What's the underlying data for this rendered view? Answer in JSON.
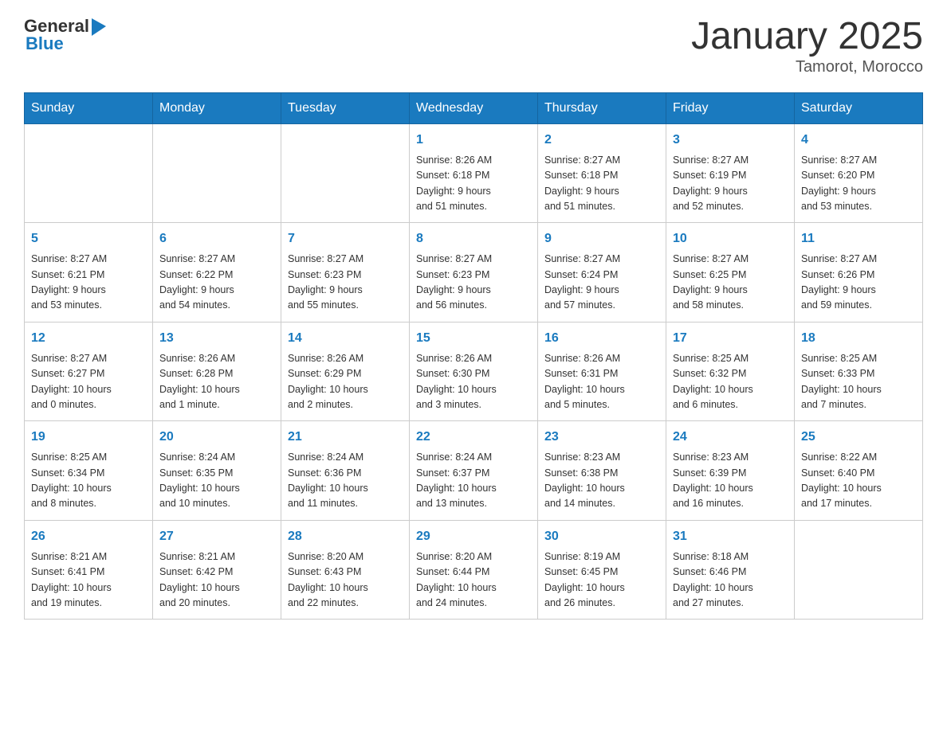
{
  "header": {
    "logo": {
      "general": "General",
      "blue": "Blue"
    },
    "title": "January 2025",
    "subtitle": "Tamorot, Morocco"
  },
  "weekdays": [
    "Sunday",
    "Monday",
    "Tuesday",
    "Wednesday",
    "Thursday",
    "Friday",
    "Saturday"
  ],
  "weeks": [
    [
      {
        "day": "",
        "info": ""
      },
      {
        "day": "",
        "info": ""
      },
      {
        "day": "",
        "info": ""
      },
      {
        "day": "1",
        "info": "Sunrise: 8:26 AM\nSunset: 6:18 PM\nDaylight: 9 hours\nand 51 minutes."
      },
      {
        "day": "2",
        "info": "Sunrise: 8:27 AM\nSunset: 6:18 PM\nDaylight: 9 hours\nand 51 minutes."
      },
      {
        "day": "3",
        "info": "Sunrise: 8:27 AM\nSunset: 6:19 PM\nDaylight: 9 hours\nand 52 minutes."
      },
      {
        "day": "4",
        "info": "Sunrise: 8:27 AM\nSunset: 6:20 PM\nDaylight: 9 hours\nand 53 minutes."
      }
    ],
    [
      {
        "day": "5",
        "info": "Sunrise: 8:27 AM\nSunset: 6:21 PM\nDaylight: 9 hours\nand 53 minutes."
      },
      {
        "day": "6",
        "info": "Sunrise: 8:27 AM\nSunset: 6:22 PM\nDaylight: 9 hours\nand 54 minutes."
      },
      {
        "day": "7",
        "info": "Sunrise: 8:27 AM\nSunset: 6:23 PM\nDaylight: 9 hours\nand 55 minutes."
      },
      {
        "day": "8",
        "info": "Sunrise: 8:27 AM\nSunset: 6:23 PM\nDaylight: 9 hours\nand 56 minutes."
      },
      {
        "day": "9",
        "info": "Sunrise: 8:27 AM\nSunset: 6:24 PM\nDaylight: 9 hours\nand 57 minutes."
      },
      {
        "day": "10",
        "info": "Sunrise: 8:27 AM\nSunset: 6:25 PM\nDaylight: 9 hours\nand 58 minutes."
      },
      {
        "day": "11",
        "info": "Sunrise: 8:27 AM\nSunset: 6:26 PM\nDaylight: 9 hours\nand 59 minutes."
      }
    ],
    [
      {
        "day": "12",
        "info": "Sunrise: 8:27 AM\nSunset: 6:27 PM\nDaylight: 10 hours\nand 0 minutes."
      },
      {
        "day": "13",
        "info": "Sunrise: 8:26 AM\nSunset: 6:28 PM\nDaylight: 10 hours\nand 1 minute."
      },
      {
        "day": "14",
        "info": "Sunrise: 8:26 AM\nSunset: 6:29 PM\nDaylight: 10 hours\nand 2 minutes."
      },
      {
        "day": "15",
        "info": "Sunrise: 8:26 AM\nSunset: 6:30 PM\nDaylight: 10 hours\nand 3 minutes."
      },
      {
        "day": "16",
        "info": "Sunrise: 8:26 AM\nSunset: 6:31 PM\nDaylight: 10 hours\nand 5 minutes."
      },
      {
        "day": "17",
        "info": "Sunrise: 8:25 AM\nSunset: 6:32 PM\nDaylight: 10 hours\nand 6 minutes."
      },
      {
        "day": "18",
        "info": "Sunrise: 8:25 AM\nSunset: 6:33 PM\nDaylight: 10 hours\nand 7 minutes."
      }
    ],
    [
      {
        "day": "19",
        "info": "Sunrise: 8:25 AM\nSunset: 6:34 PM\nDaylight: 10 hours\nand 8 minutes."
      },
      {
        "day": "20",
        "info": "Sunrise: 8:24 AM\nSunset: 6:35 PM\nDaylight: 10 hours\nand 10 minutes."
      },
      {
        "day": "21",
        "info": "Sunrise: 8:24 AM\nSunset: 6:36 PM\nDaylight: 10 hours\nand 11 minutes."
      },
      {
        "day": "22",
        "info": "Sunrise: 8:24 AM\nSunset: 6:37 PM\nDaylight: 10 hours\nand 13 minutes."
      },
      {
        "day": "23",
        "info": "Sunrise: 8:23 AM\nSunset: 6:38 PM\nDaylight: 10 hours\nand 14 minutes."
      },
      {
        "day": "24",
        "info": "Sunrise: 8:23 AM\nSunset: 6:39 PM\nDaylight: 10 hours\nand 16 minutes."
      },
      {
        "day": "25",
        "info": "Sunrise: 8:22 AM\nSunset: 6:40 PM\nDaylight: 10 hours\nand 17 minutes."
      }
    ],
    [
      {
        "day": "26",
        "info": "Sunrise: 8:21 AM\nSunset: 6:41 PM\nDaylight: 10 hours\nand 19 minutes."
      },
      {
        "day": "27",
        "info": "Sunrise: 8:21 AM\nSunset: 6:42 PM\nDaylight: 10 hours\nand 20 minutes."
      },
      {
        "day": "28",
        "info": "Sunrise: 8:20 AM\nSunset: 6:43 PM\nDaylight: 10 hours\nand 22 minutes."
      },
      {
        "day": "29",
        "info": "Sunrise: 8:20 AM\nSunset: 6:44 PM\nDaylight: 10 hours\nand 24 minutes."
      },
      {
        "day": "30",
        "info": "Sunrise: 8:19 AM\nSunset: 6:45 PM\nDaylight: 10 hours\nand 26 minutes."
      },
      {
        "day": "31",
        "info": "Sunrise: 8:18 AM\nSunset: 6:46 PM\nDaylight: 10 hours\nand 27 minutes."
      },
      {
        "day": "",
        "info": ""
      }
    ]
  ]
}
